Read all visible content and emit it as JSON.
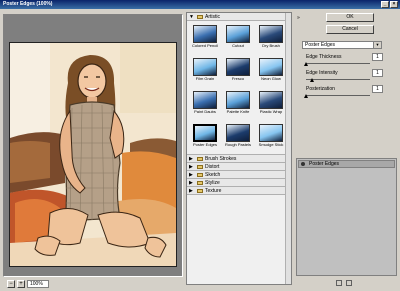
{
  "window": {
    "title": "Poster Edges (100%)"
  },
  "preview": {
    "zoom": "100%",
    "zoom_out": "−",
    "zoom_in": "+"
  },
  "gallery": {
    "open_category": "Artistic",
    "filters": [
      "Colored Pencil",
      "Cutout",
      "Dry Brush",
      "Film Grain",
      "Fresco",
      "Neon Glow",
      "Paint Daubs",
      "Palette Knife",
      "Plastic Wrap",
      "Poster Edges",
      "Rough Pastels",
      "Smudge Stick",
      "Sponge",
      "Underpainting",
      "Watercolor"
    ],
    "selected_filter": "Poster Edges",
    "collapsed_categories": [
      "Brush Strokes",
      "Distort",
      "Sketch",
      "Stylize",
      "Texture"
    ]
  },
  "settings": {
    "ok_label": "OK",
    "cancel_label": "Cancel",
    "filter_select": "Poster Edges",
    "params": [
      {
        "label": "Edge Thickness",
        "value": "1",
        "fraction": 0.0
      },
      {
        "label": "Edge Intensity",
        "value": "1",
        "fraction": 0.1
      },
      {
        "label": "Posterization",
        "value": "1",
        "fraction": 0.0
      }
    ]
  },
  "layers": {
    "row_label": "Poster Edges"
  },
  "colors": {
    "title_bar": "#0a246a",
    "panel": "#d4d0c8",
    "preview_bg": "#7f7f7f"
  }
}
